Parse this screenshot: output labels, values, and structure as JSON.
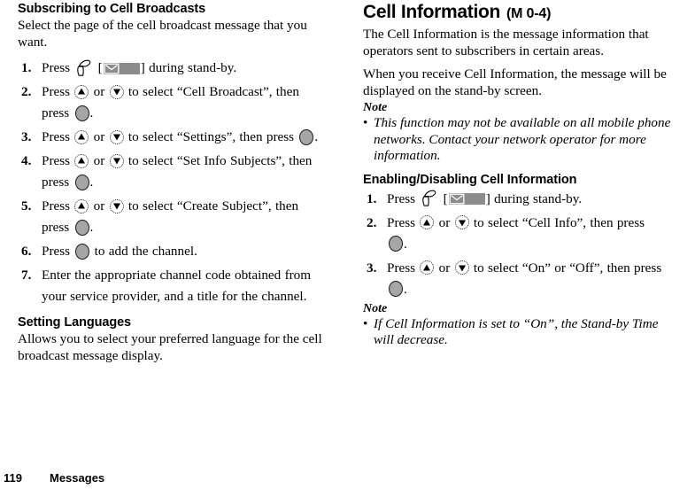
{
  "footer": {
    "page_number": "119",
    "chapter": "Messages"
  },
  "left_column": {
    "section_title": "Subscribing to Cell Broadcasts",
    "intro": "Select the page of the cell broadcast message that you want.",
    "steps": [
      {
        "num": "1.",
        "lines": [
          {
            "parts": [
              {
                "type": "text",
                "value": "Press "
              },
              {
                "type": "icon",
                "icon": "softkey-icon"
              },
              {
                "type": "text",
                "value": " ["
              },
              {
                "type": "icon",
                "icon": "message-indicator-icon"
              },
              {
                "type": "text",
                "value": "] during stand-by."
              }
            ]
          }
        ]
      },
      {
        "num": "2.",
        "lines": [
          {
            "parts": [
              {
                "type": "text",
                "value": "Press "
              },
              {
                "type": "icon",
                "icon": "nav-up-icon"
              },
              {
                "type": "text",
                "value": " or "
              },
              {
                "type": "icon",
                "icon": "nav-down-icon"
              },
              {
                "type": "text",
                "value": " to select “Cell Broadcast”, then"
              }
            ]
          },
          {
            "parts": [
              {
                "type": "text",
                "value": "press "
              },
              {
                "type": "icon",
                "icon": "center-select-key-icon"
              },
              {
                "type": "text",
                "value": "."
              }
            ]
          }
        ]
      },
      {
        "num": "3.",
        "lines": [
          {
            "parts": [
              {
                "type": "text",
                "value": "Press "
              },
              {
                "type": "icon",
                "icon": "nav-up-icon"
              },
              {
                "type": "text",
                "value": " or "
              },
              {
                "type": "icon",
                "icon": "nav-down-icon"
              },
              {
                "type": "text",
                "value": " to select “Settings”, then press "
              },
              {
                "type": "icon",
                "icon": "center-select-key-icon"
              },
              {
                "type": "text",
                "value": "."
              }
            ]
          }
        ]
      },
      {
        "num": "4.",
        "lines": [
          {
            "parts": [
              {
                "type": "text",
                "value": "Press "
              },
              {
                "type": "icon",
                "icon": "nav-up-icon"
              },
              {
                "type": "text",
                "value": " or "
              },
              {
                "type": "icon",
                "icon": "nav-down-icon"
              },
              {
                "type": "text",
                "value": " to select “Set Info Subjects”, then"
              }
            ]
          },
          {
            "parts": [
              {
                "type": "text",
                "value": "press "
              },
              {
                "type": "icon",
                "icon": "center-select-key-icon"
              },
              {
                "type": "text",
                "value": "."
              }
            ]
          }
        ]
      },
      {
        "num": "5.",
        "lines": [
          {
            "parts": [
              {
                "type": "text",
                "value": "Press "
              },
              {
                "type": "icon",
                "icon": "nav-up-icon"
              },
              {
                "type": "text",
                "value": " or "
              },
              {
                "type": "icon",
                "icon": "nav-down-icon"
              },
              {
                "type": "text",
                "value": " to select “Create Subject”, then"
              }
            ]
          },
          {
            "parts": [
              {
                "type": "text",
                "value": "press "
              },
              {
                "type": "icon",
                "icon": "center-select-key-icon"
              },
              {
                "type": "text",
                "value": "."
              }
            ]
          }
        ]
      },
      {
        "num": "6.",
        "lines": [
          {
            "parts": [
              {
                "type": "text",
                "value": "Press "
              },
              {
                "type": "icon",
                "icon": "center-select-key-icon"
              },
              {
                "type": "text",
                "value": " to add the channel."
              }
            ]
          }
        ]
      },
      {
        "num": "7.",
        "lines": [
          {
            "parts": [
              {
                "type": "text",
                "value": "Enter the appropriate channel code obtained from"
              }
            ]
          },
          {
            "parts": [
              {
                "type": "text",
                "value": "your service provider, and a title for the channel."
              }
            ]
          }
        ]
      }
    ],
    "languages_title": "Setting Languages",
    "languages_body": "Allows you to select your preferred language for the cell broadcast message display."
  },
  "right_column": {
    "chapter_title": "Cell Information",
    "chapter_code": "(M 0-4)",
    "para1": "The Cell Information is the message information that operators sent to subscribers in certain areas.",
    "para2": "When you receive Cell Information, the message will be displayed on the stand-by screen.",
    "note1_label": "Note",
    "note1_bullet": "•",
    "note1_text": "This function may not be available on all mobile phone networks. Contact your network operator for more information.",
    "enabling_title": "Enabling/Disabling Cell Information",
    "steps": [
      {
        "num": "1.",
        "lines": [
          {
            "parts": [
              {
                "type": "text",
                "value": "Press "
              },
              {
                "type": "icon",
                "icon": "softkey-icon"
              },
              {
                "type": "text",
                "value": " ["
              },
              {
                "type": "icon",
                "icon": "message-indicator-icon"
              },
              {
                "type": "text",
                "value": "] during stand-by."
              }
            ]
          }
        ]
      },
      {
        "num": "2.",
        "lines": [
          {
            "parts": [
              {
                "type": "text",
                "value": "Press "
              },
              {
                "type": "icon",
                "icon": "nav-up-icon"
              },
              {
                "type": "text",
                "value": " or "
              },
              {
                "type": "icon",
                "icon": "nav-down-icon"
              },
              {
                "type": "text",
                "value": " to select “Cell Info”, then press"
              }
            ]
          },
          {
            "parts": [
              {
                "type": "icon",
                "icon": "center-select-key-icon"
              },
              {
                "type": "text",
                "value": "."
              }
            ]
          }
        ]
      },
      {
        "num": "3.",
        "lines": [
          {
            "parts": [
              {
                "type": "text",
                "value": "Press "
              },
              {
                "type": "icon",
                "icon": "nav-up-icon"
              },
              {
                "type": "text",
                "value": " or "
              },
              {
                "type": "icon",
                "icon": "nav-down-icon"
              },
              {
                "type": "text",
                "value": " to select “On” or “Off”, then press"
              }
            ]
          },
          {
            "parts": [
              {
                "type": "icon",
                "icon": "center-select-key-icon"
              },
              {
                "type": "text",
                "value": "."
              }
            ]
          }
        ]
      }
    ],
    "note2_label": "Note",
    "note2_bullet": "•",
    "note2_text": "If Cell Information is set to “On”, the Stand-by Time will decrease."
  },
  "colors": {
    "text": "#000000",
    "key_gray": "#a6a6a6",
    "indicator_gray": "#8c8c8c",
    "background": "#ffffff"
  }
}
